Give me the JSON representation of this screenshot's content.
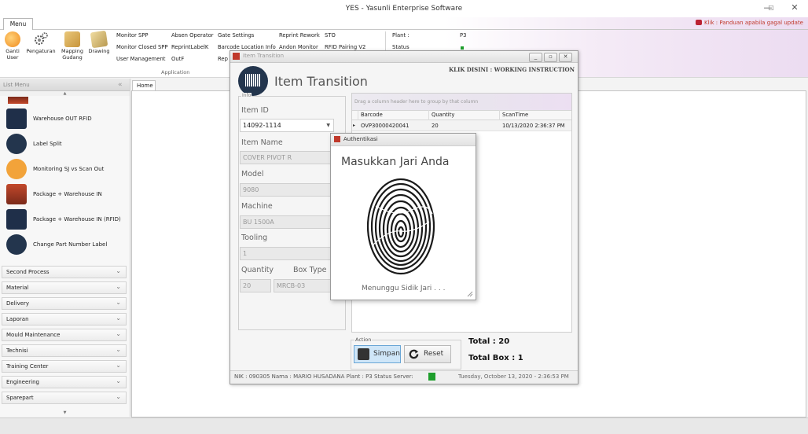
{
  "window": {
    "title": "YES - Yasunli Enterprise Software",
    "minimize": "—",
    "maximize": "☐",
    "close": "✕"
  },
  "ribbon": {
    "menu_tab": "Menu",
    "help_link": "Klik : Panduan apabila gagal update",
    "big_buttons": [
      {
        "label": "Ganti User",
        "icon": "user-switch-icon"
      },
      {
        "label": "Pengaturan",
        "icon": "settings-gears-icon"
      },
      {
        "label": "Mapping Gudang",
        "icon": "warehouse-map-icon"
      },
      {
        "label": "Drawing",
        "icon": "drawing-icon"
      }
    ],
    "col1": [
      "Monitor SPP",
      "Monitor Closed SPP",
      "User Management"
    ],
    "col2": [
      "Absen Operator",
      "ReprintLabelK",
      "OutF"
    ],
    "col3": [
      "Gate Settings",
      "Barcode Location Info",
      "Rep"
    ],
    "col4": [
      "Reprint Rework",
      "Andon Monitor"
    ],
    "col5": [
      "STO",
      "RFID Pairing V2"
    ],
    "plant_label": "Plant :",
    "plant_value": "P3",
    "status_label": "Status",
    "group_label": "Application"
  },
  "left_menu": {
    "header": "List Menu",
    "items": [
      {
        "label": "Warehouse OUT RFID",
        "icon": "warehouse-rfid-icon"
      },
      {
        "label": "Label Split",
        "icon": "barcode-icon"
      },
      {
        "label": "Monitoring SJ vs Scan Out",
        "icon": "clipboard-icon"
      },
      {
        "label": "Package + Warehouse IN",
        "icon": "warehouse-in-icon"
      },
      {
        "label": "Package + Warehouse IN (RFID)",
        "icon": "warehouse-rfid-icon"
      },
      {
        "label": "Change Part Number Label",
        "icon": "barcode-icon"
      }
    ],
    "sections": [
      "Second Process",
      "Material",
      "Delivery",
      "Laporan",
      "Mould Maintenance",
      "Technisi",
      "Training Center",
      "Engineering",
      "Sparepart"
    ]
  },
  "main": {
    "home_tab": "Home"
  },
  "item_transition": {
    "window_title": "Item Transition",
    "title": "Item Transition",
    "instruction_link": "KLIK DISINI : WORKING INSTRUCTION",
    "info_label": "Info",
    "fields": {
      "item_id_label": "Item ID",
      "item_id_value": "14092-1114",
      "item_name_label": "Item Name",
      "item_name_value": "COVER PIVOT R",
      "model_label": "Model",
      "model_value": "9080",
      "machine_label": "Machine",
      "machine_value": "BU 1500A",
      "tooling_label": "Tooling",
      "tooling_value": "1",
      "quantity_label": "Quantity",
      "quantity_value": "20",
      "box_type_label": "Box Type",
      "box_type_value": "MRCB-03"
    },
    "grid": {
      "group_hint": "Drag a column header here to group by that column",
      "columns": [
        "Barcode",
        "Quantity",
        "ScanTime"
      ],
      "rows": [
        {
          "barcode": "OVP30000420041",
          "quantity": "20",
          "scantime": "10/13/2020 2:36:37 PM"
        }
      ]
    },
    "action_label": "Action",
    "save_label": "Simpan",
    "reset_label": "Reset",
    "total": "Total : 20",
    "total_box": "Total Box : 1",
    "status": {
      "text": "NIK :  090305  Nama :  MARIO HUSADANA  Plant :  P3  Status Server:",
      "server_color": "#1e9e2c",
      "datetime": "Tuesday, October 13, 2020 - 2:36:53 PM"
    }
  },
  "auth": {
    "title": "Authentikasi",
    "prompt": "Masukkan Jari Anda",
    "waiting": "Menunggu Sidik Jari . . ."
  }
}
